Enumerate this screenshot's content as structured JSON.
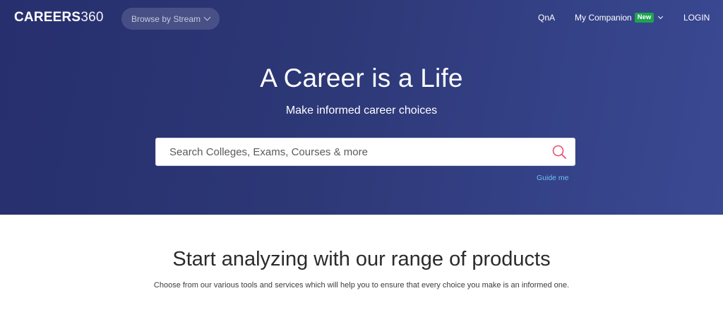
{
  "header": {
    "logo_bold": "CAREERS",
    "logo_light": "360",
    "browse_label": "Browse by Stream",
    "nav": {
      "qna": "QnA",
      "companion": "My Companion",
      "companion_badge": "New",
      "login": "LOGIN"
    }
  },
  "hero": {
    "title": "A Career is a Life",
    "subtitle": "Make informed career choices",
    "search_placeholder": "Search Colleges, Exams, Courses & more",
    "search_value": "",
    "guide_link": "Guide me"
  },
  "products": {
    "title": "Start analyzing with our range of products",
    "subtitle": "Choose from our various tools and services which will help you to ensure that every choice you make is an informed one."
  },
  "colors": {
    "hero_start": "#272f6e",
    "hero_end": "#3a4993",
    "badge_new": "#1ea34f",
    "link": "#6ec1f5",
    "search_icon": "#e8536b"
  },
  "icons": {
    "search": "search-icon",
    "browse_chevron": "chevron-down-icon",
    "companion_chevron": "chevron-down-icon"
  }
}
